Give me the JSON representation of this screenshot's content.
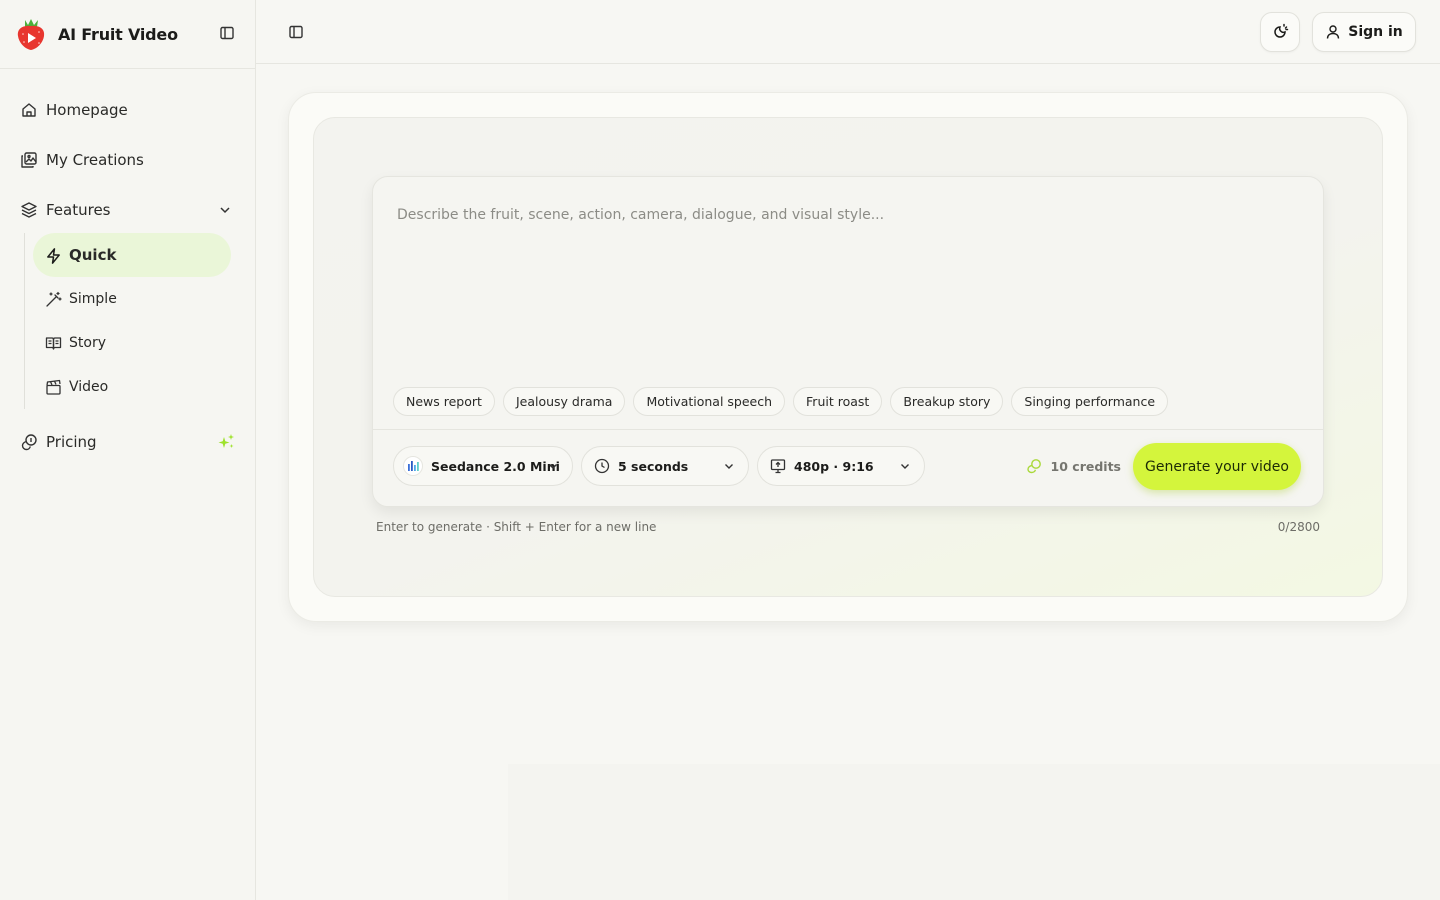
{
  "brand": {
    "name": "AI Fruit Video"
  },
  "nav": {
    "homepage": "Homepage",
    "my_creations": "My Creations",
    "features": "Features",
    "sub": {
      "quick": "Quick",
      "simple": "Simple",
      "story": "Story",
      "video": "Video"
    },
    "pricing": "Pricing"
  },
  "topbar": {
    "sign_in": "Sign in"
  },
  "composer": {
    "placeholder": "Describe the fruit, scene, action, camera, dialogue, and visual style...",
    "chips": [
      "News report",
      "Jealousy drama",
      "Motivational speech",
      "Fruit roast",
      "Breakup story",
      "Singing performance"
    ],
    "model": "Seedance 2.0 Mini",
    "duration": "5 seconds",
    "resolution": "480p · 9:16",
    "credits": "10 credits",
    "generate": "Generate your video"
  },
  "hint": "Enter to generate · Shift + Enter for a new line",
  "counter": "0/2800",
  "colors": {
    "accent": "#d4f53c",
    "active_bg": "#eaf6d8",
    "logo_red": "#e8362f",
    "logo_green": "#6cc24a"
  },
  "icons": {
    "theme": "theme-toggle-icon",
    "user": "user-icon",
    "home": "home-icon",
    "creations": "image-gallery-icon",
    "features": "layers-icon",
    "quick": "bolt-icon",
    "simple": "magic-wand-icon",
    "story": "book-icon",
    "video": "clapperboard-icon",
    "pricing": "coins-icon",
    "sparkle": "sparkles-icon"
  }
}
